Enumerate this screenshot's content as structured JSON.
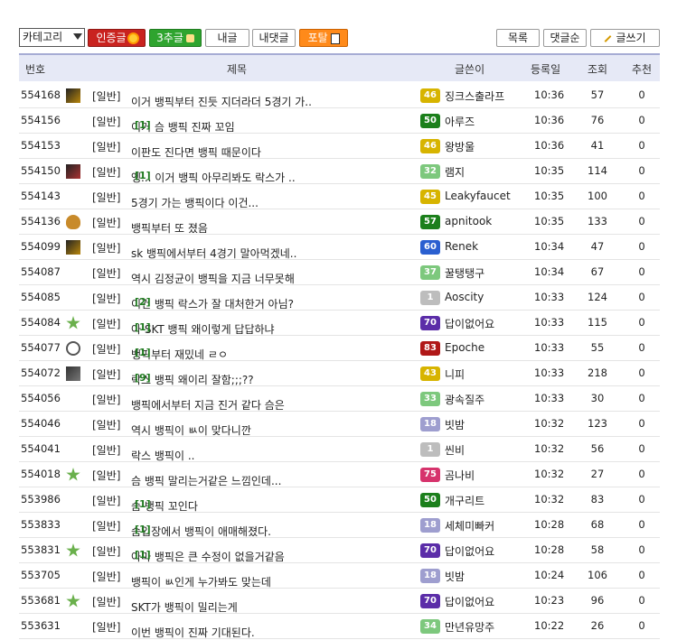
{
  "toolbar": {
    "category_select": "카테고리",
    "certified_label": "인증글",
    "popular_label": "3추글",
    "my_posts_label": "내글",
    "my_comments_label": "내댓글",
    "portal_label": "포탈",
    "list_label": "목록",
    "comment_order_label": "댓글순",
    "write_label": "글쓰기"
  },
  "header": {
    "number": "번호",
    "title": "제목",
    "author": "글쓴이",
    "date": "등록일",
    "views": "조회",
    "recommend": "추천"
  },
  "colors": {
    "header_bg": "#e6e9f6",
    "header_border": "#a6acd4",
    "comment_count": "#1f7a1f"
  },
  "rows": [
    {
      "num": "554168",
      "avatar": "av-dark",
      "cat": "[일반]",
      "title": "이거 뱅픽부터 진듯 지더라더 5경기 가..",
      "comments": "",
      "level": "46",
      "badge_color": "#d7b400",
      "nick": "징크스출라프",
      "time": "10:36",
      "views": "57",
      "rec": "0"
    },
    {
      "num": "554156",
      "avatar": "",
      "cat": "[일반]",
      "title": "이거 슴 뱅픽 진짜 꼬임",
      "comments": "[1]",
      "level": "50",
      "badge_color": "#1b7f1b",
      "nick": "아루즈",
      "time": "10:36",
      "views": "76",
      "rec": "0"
    },
    {
      "num": "554153",
      "avatar": "",
      "cat": "[일반]",
      "title": "이판도 진다면 뱅픽 때문이다",
      "comments": "",
      "level": "46",
      "badge_color": "#d7b400",
      "nick": "왕방울",
      "time": "10:36",
      "views": "41",
      "rec": "0"
    },
    {
      "num": "554150",
      "avatar": "av-red",
      "cat": "[일반]",
      "title": "엥... 이거 뱅픽 아무리봐도 락스가 ..",
      "comments": "[1]",
      "level": "32",
      "badge_color": "#7dc87d",
      "nick": "램지",
      "time": "10:35",
      "views": "114",
      "rec": "0"
    },
    {
      "num": "554143",
      "avatar": "",
      "cat": "[일반]",
      "title": "5경기 가는 뱅픽이다 이건...",
      "comments": "",
      "level": "45",
      "badge_color": "#d7b400",
      "nick": "Leakyfaucet",
      "time": "10:35",
      "views": "100",
      "rec": "0"
    },
    {
      "num": "554136",
      "avatar": "av-acorn",
      "cat": "[일반]",
      "title": "뱅픽부터 또 졌음",
      "comments": "",
      "level": "57",
      "badge_color": "#1b7f1b",
      "nick": "apnitook",
      "time": "10:35",
      "views": "133",
      "rec": "0"
    },
    {
      "num": "554099",
      "avatar": "av-dark",
      "cat": "[일반]",
      "title": "sk 뱅픽에서부터 4경기 말아먹겠네..",
      "comments": "",
      "level": "60",
      "badge_color": "#2a5fd0",
      "nick": "Renek",
      "time": "10:34",
      "views": "47",
      "rec": "0"
    },
    {
      "num": "554087",
      "avatar": "av-logo",
      "cat": "[일반]",
      "title": "역시 김정균이 뱅픽을 지금 너무못해",
      "comments": "",
      "level": "37",
      "badge_color": "#7dc87d",
      "nick": "꿀탱탱구",
      "time": "10:34",
      "views": "67",
      "rec": "0"
    },
    {
      "num": "554085",
      "avatar": "",
      "cat": "[일반]",
      "title": "이건 뱅픽 락스가 잘 대처한거 아님?",
      "comments": "[2]",
      "level": "1",
      "badge_color": "#bdbdbd",
      "nick": "Aoscity",
      "time": "10:33",
      "views": "124",
      "rec": "0"
    },
    {
      "num": "554084",
      "avatar": "av-star",
      "cat": "[일반]",
      "title": "아 SKT 뱅픽 왜이렇게 답답하냐",
      "comments": "[1]",
      "level": "70",
      "badge_color": "#5b2da8",
      "nick": "답이없어요",
      "time": "10:33",
      "views": "115",
      "rec": "0"
    },
    {
      "num": "554077",
      "avatar": "av-ring",
      "cat": "[일반]",
      "title": "뱅픽부터 재밌네 ㄹㅇ",
      "comments": "[1]",
      "level": "83",
      "badge_color": "#b01818",
      "nick": "Epoche",
      "time": "10:33",
      "views": "55",
      "rec": "0"
    },
    {
      "num": "554072",
      "avatar": "av-gray",
      "cat": "[일반]",
      "title": "락스 뱅픽 왜이리 잘함;;;??",
      "comments": "[9]",
      "level": "43",
      "badge_color": "#d7b400",
      "nick": "니피",
      "time": "10:33",
      "views": "218",
      "rec": "0"
    },
    {
      "num": "554056",
      "avatar": "",
      "cat": "[일반]",
      "title": "뱅픽에서부터 지금 진거 같다 슴은",
      "comments": "",
      "level": "33",
      "badge_color": "#7dc87d",
      "nick": "광속질주",
      "time": "10:33",
      "views": "30",
      "rec": "0"
    },
    {
      "num": "554046",
      "avatar": "",
      "cat": "[일반]",
      "title": "역시 뱅픽이 ㅄ이 맞다니깐",
      "comments": "",
      "level": "18",
      "badge_color": "#9e9ecf",
      "nick": "빗밤",
      "time": "10:32",
      "views": "123",
      "rec": "0"
    },
    {
      "num": "554041",
      "avatar": "",
      "cat": "[일반]",
      "title": "락스 뱅픽이 ..",
      "comments": "",
      "level": "1",
      "badge_color": "#bdbdbd",
      "nick": "씬비",
      "time": "10:32",
      "views": "56",
      "rec": "0"
    },
    {
      "num": "554018",
      "avatar": "av-star",
      "cat": "[일반]",
      "title": "슴 뱅픽 말리는거같은 느낌인데...",
      "comments": "",
      "level": "75",
      "badge_color": "#d6336c",
      "nick": "곰나비",
      "time": "10:32",
      "views": "27",
      "rec": "0"
    },
    {
      "num": "553986",
      "avatar": "",
      "cat": "[일반]",
      "title": "슴 뱅픽 꼬인다",
      "comments": "[1]",
      "level": "50",
      "badge_color": "#1b7f1b",
      "nick": "개구리트",
      "time": "10:32",
      "views": "83",
      "rec": "0"
    },
    {
      "num": "553833",
      "avatar": "",
      "cat": "[일반]",
      "title": "슴입장에서 뱅픽이 애매해졌다.",
      "comments": "[1]",
      "level": "18",
      "badge_color": "#9e9ecf",
      "nick": "세체미빠커",
      "time": "10:28",
      "views": "68",
      "rec": "0"
    },
    {
      "num": "553831",
      "avatar": "av-star",
      "cat": "[일반]",
      "title": "아마 뱅픽은 큰 수정이 없을거같음",
      "comments": "[1]",
      "level": "70",
      "badge_color": "#5b2da8",
      "nick": "답이없어요",
      "time": "10:28",
      "views": "58",
      "rec": "0"
    },
    {
      "num": "553705",
      "avatar": "",
      "cat": "[일반]",
      "title": "뱅픽이 ㅄ인게 누가봐도 맞는데",
      "comments": "",
      "level": "18",
      "badge_color": "#9e9ecf",
      "nick": "빗밤",
      "time": "10:24",
      "views": "106",
      "rec": "0"
    },
    {
      "num": "553681",
      "avatar": "av-star",
      "cat": "[일반]",
      "title": "SKT가 뱅픽이 밀리는게",
      "comments": "",
      "level": "70",
      "badge_color": "#5b2da8",
      "nick": "답이없어요",
      "time": "10:23",
      "views": "96",
      "rec": "0"
    },
    {
      "num": "553631",
      "avatar": "",
      "cat": "[일반]",
      "title": "이번 뱅픽이 진짜 기대된다.",
      "comments": "",
      "level": "34",
      "badge_color": "#7dc87d",
      "nick": "만년유망주",
      "time": "10:22",
      "views": "26",
      "rec": "0"
    }
  ]
}
